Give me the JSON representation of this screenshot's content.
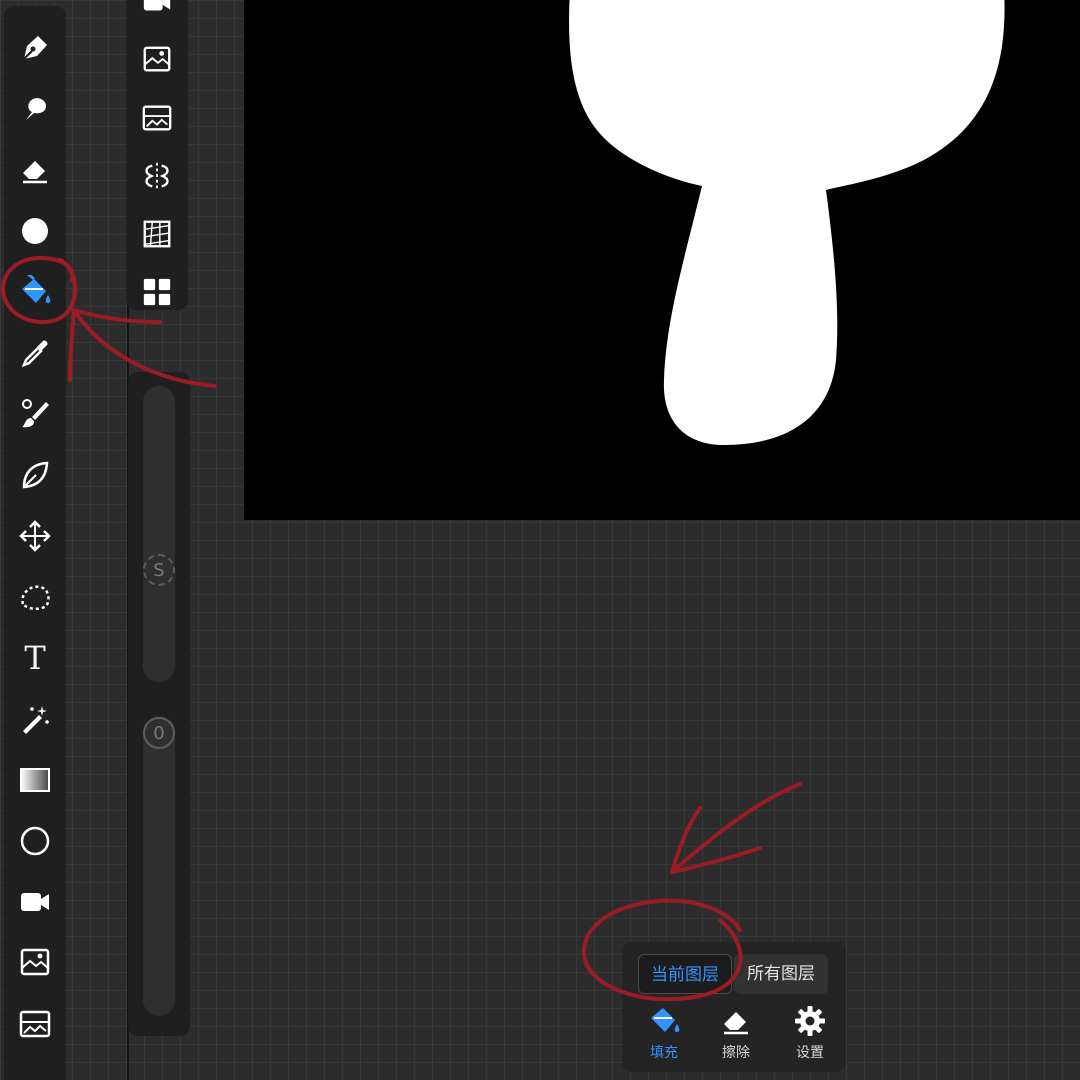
{
  "canvas": {
    "background": "#000000",
    "shape_color": "#ffffff"
  },
  "toolbar": {
    "tools": [
      {
        "icon": "pen-icon"
      },
      {
        "icon": "smudge-icon"
      },
      {
        "icon": "eraser-icon"
      },
      {
        "icon": "color-circle-icon"
      },
      {
        "icon": "fill-bucket-icon",
        "selected": true
      },
      {
        "icon": "eyedropper-icon"
      },
      {
        "icon": "brush-icon"
      },
      {
        "icon": "leaf-icon"
      },
      {
        "icon": "move-icon"
      },
      {
        "icon": "lasso-icon"
      },
      {
        "icon": "text-icon",
        "glyph": "T"
      },
      {
        "icon": "magic-wand-icon"
      },
      {
        "icon": "gradient-icon"
      },
      {
        "icon": "circle-shape-icon"
      },
      {
        "icon": "video-icon"
      },
      {
        "icon": "image-import-icon"
      },
      {
        "icon": "image-adjust-icon"
      }
    ]
  },
  "subbar": {
    "tools": [
      {
        "icon": "video-icon"
      },
      {
        "icon": "image-import-icon"
      },
      {
        "icon": "image-adjust-icon"
      },
      {
        "icon": "symmetry-icon"
      },
      {
        "icon": "perspective-icon"
      },
      {
        "icon": "grid-layout-icon"
      }
    ]
  },
  "sliders": {
    "size_knob": "S",
    "opacity_knob": "0"
  },
  "fill_panel": {
    "tabs": [
      {
        "label": "当前图层",
        "active": true
      },
      {
        "label": "所有图层",
        "active": false
      }
    ],
    "actions": [
      {
        "label": "填充",
        "icon": "fill-bucket-icon",
        "active": true
      },
      {
        "label": "擦除",
        "icon": "eraser-icon",
        "active": false
      },
      {
        "label": "设置",
        "icon": "gear-icon",
        "active": false
      }
    ]
  },
  "colors": {
    "accent": "#2f95ff",
    "annotation": "#9b1c24"
  }
}
